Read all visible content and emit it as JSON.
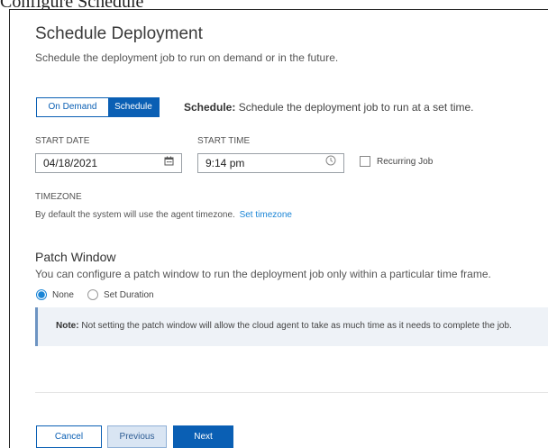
{
  "window": {
    "top_cut_text": "Configure Schedule"
  },
  "header": {
    "title": "Schedule Deployment",
    "subtitle": "Schedule the deployment job to run on demand or in the future."
  },
  "mode": {
    "options": [
      "On Demand",
      "Schedule"
    ],
    "selected": "Schedule",
    "desc_bold": "Schedule:",
    "desc_text": " Schedule the deployment job to run at a set time."
  },
  "start_date": {
    "label": "START DATE",
    "value": "04/18/2021"
  },
  "start_time": {
    "label": "START TIME",
    "value": "9:14 pm"
  },
  "recurring": {
    "label": "Recurring Job",
    "checked": false
  },
  "timezone": {
    "label": "TIMEZONE",
    "desc": "By default the system will use the agent timezone.",
    "link": "Set timezone"
  },
  "patch_window": {
    "title": "Patch Window",
    "desc": "You can configure a patch window to run the deployment job only within a particular time frame.",
    "options": [
      "None",
      "Set Duration"
    ],
    "selected": "None"
  },
  "note": {
    "bold": "Note:",
    "text": " Not setting the patch window will allow the cloud agent to take as much time as it needs to complete the job."
  },
  "footer": {
    "cancel": "Cancel",
    "previous": "Previous",
    "next": "Next"
  },
  "colors": {
    "primary": "#0a5fb4",
    "link": "#1a85d6",
    "note_bg": "#eef2f7"
  }
}
